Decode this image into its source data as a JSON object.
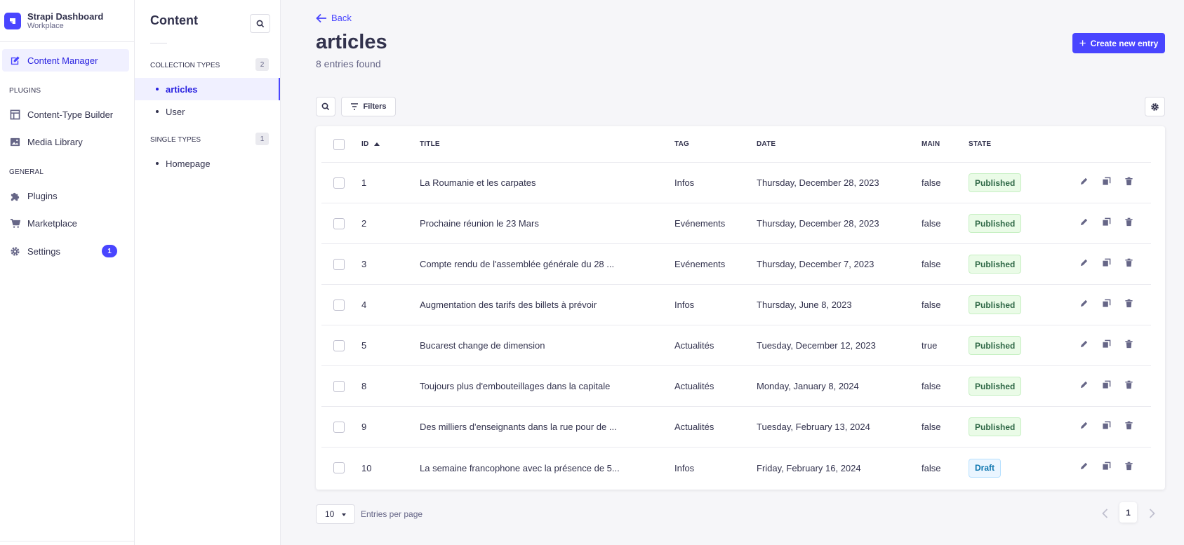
{
  "app": {
    "brand_title": "Strapi Dashboard",
    "brand_subtitle": "Workplace"
  },
  "mainnav": {
    "content_manager": "Content Manager",
    "plugins_section": "PLUGINS",
    "content_type_builder": "Content-Type Builder",
    "media_library": "Media Library",
    "general_section": "GENERAL",
    "plugins": "Plugins",
    "marketplace": "Marketplace",
    "settings": "Settings",
    "settings_badge": "1"
  },
  "subnav": {
    "title": "Content",
    "collection_types_label": "COLLECTION TYPES",
    "collection_types_count": "2",
    "collection_items": [
      "articles",
      "User"
    ],
    "single_types_label": "SINGLE TYPES",
    "single_types_count": "1",
    "single_items": [
      "Homepage"
    ]
  },
  "header": {
    "back": "Back",
    "title": "articles",
    "subtitle": "8 entries found",
    "create_button": "Create new entry",
    "filters_button": "Filters"
  },
  "table": {
    "columns": {
      "id": "ID",
      "title": "TITLE",
      "tag": "TAG",
      "date": "DATE",
      "main": "MAIN",
      "state": "STATE"
    },
    "rows": [
      {
        "id": "1",
        "title": "La Roumanie et les carpates",
        "tag": "Infos",
        "date": "Thursday, December 28, 2023",
        "main": "false",
        "state": "Published"
      },
      {
        "id": "2",
        "title": "Prochaine réunion le 23 Mars",
        "tag": "Evénements",
        "date": "Thursday, December 28, 2023",
        "main": "false",
        "state": "Published"
      },
      {
        "id": "3",
        "title": "Compte rendu de l'assemblée générale du 28 ...",
        "tag": "Evénements",
        "date": "Thursday, December 7, 2023",
        "main": "false",
        "state": "Published"
      },
      {
        "id": "4",
        "title": "Augmentation des tarifs des billets à prévoir",
        "tag": "Infos",
        "date": "Thursday, June 8, 2023",
        "main": "false",
        "state": "Published"
      },
      {
        "id": "5",
        "title": "Bucarest change de dimension",
        "tag": "Actualités",
        "date": "Tuesday, December 12, 2023",
        "main": "true",
        "state": "Published"
      },
      {
        "id": "8",
        "title": "Toujours plus d'embouteillages dans la capitale",
        "tag": "Actualités",
        "date": "Monday, January 8, 2024",
        "main": "false",
        "state": "Published"
      },
      {
        "id": "9",
        "title": "Des milliers d'enseignants dans la rue pour de ...",
        "tag": "Actualités",
        "date": "Tuesday, February 13, 2024",
        "main": "false",
        "state": "Published"
      },
      {
        "id": "10",
        "title": "La semaine francophone avec la présence de 5...",
        "tag": "Infos",
        "date": "Friday, February 16, 2024",
        "main": "false",
        "state": "Draft"
      }
    ]
  },
  "footer": {
    "page_size": "10",
    "page_size_label": "Entries per page",
    "current_page": "1"
  },
  "colors": {
    "accent": "#4945ff",
    "published_bg": "#eafbe7",
    "published_text": "#2f6846",
    "draft_bg": "#eaf5ff",
    "draft_text": "#0c75af"
  },
  "icons": {
    "edit": "pencil-icon",
    "duplicate": "duplicate-icon",
    "delete": "trash-icon"
  }
}
